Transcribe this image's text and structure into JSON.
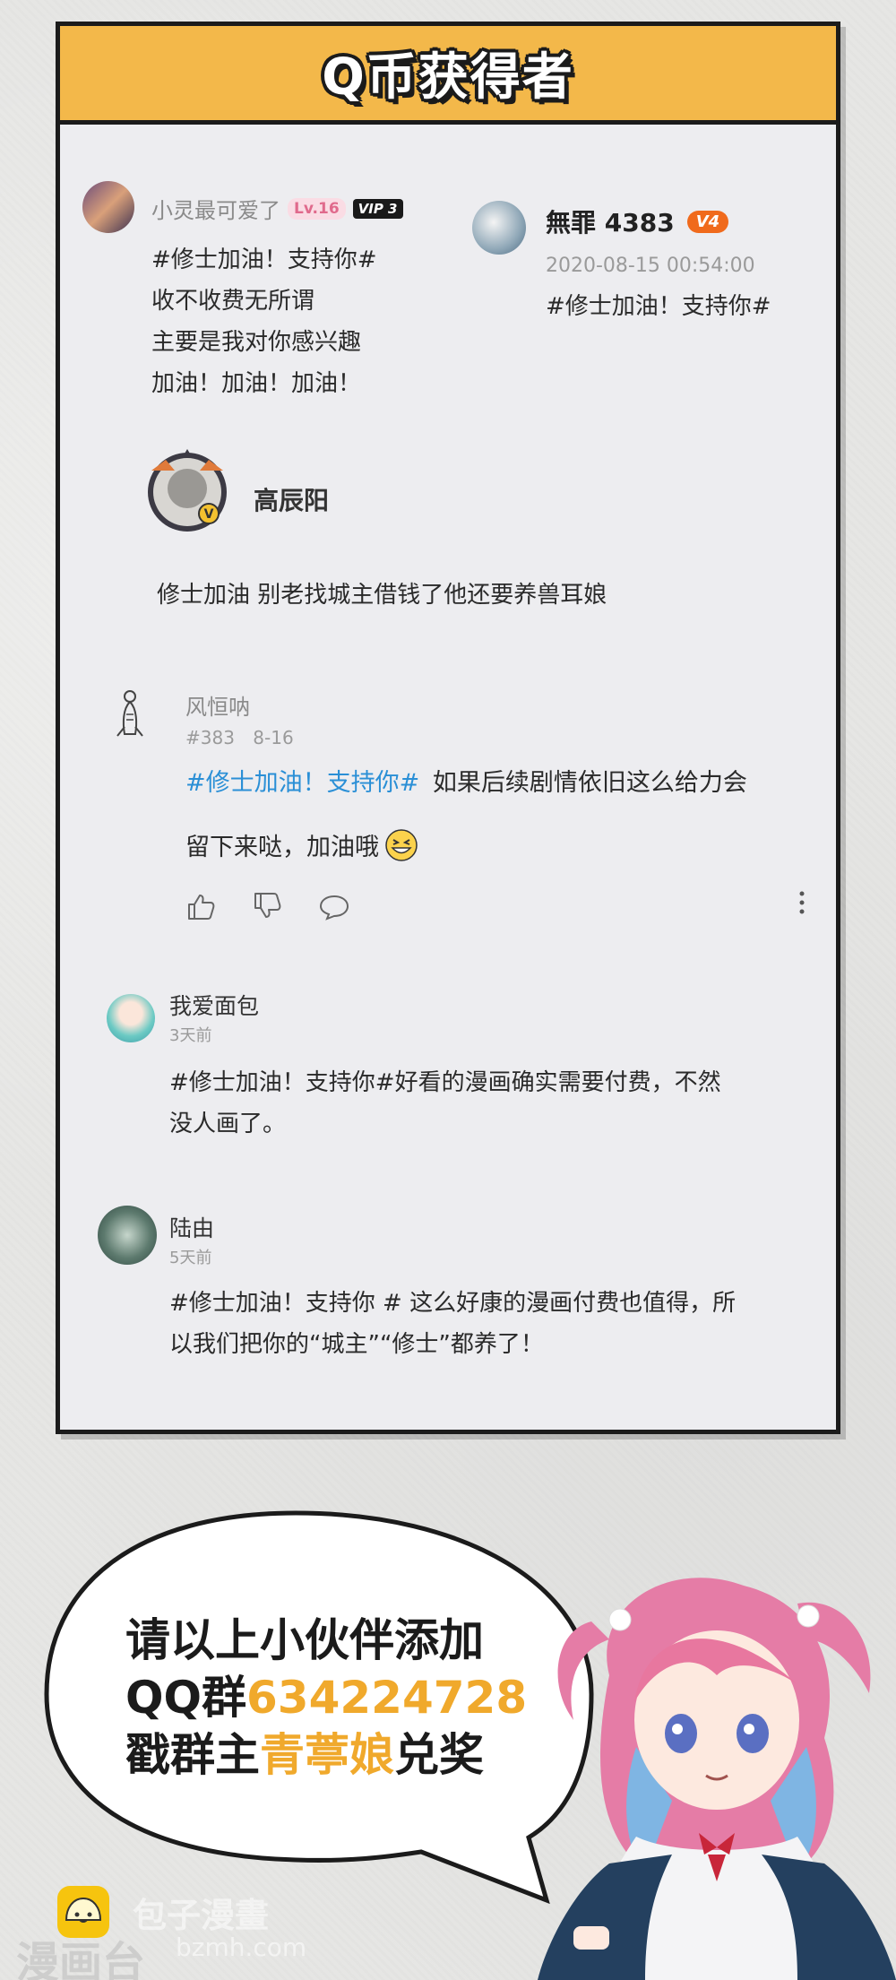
{
  "panel": {
    "title": "Q币获得者"
  },
  "comments": [
    {
      "user": "小灵最可爱了",
      "level": "Lv.16",
      "vip": "VIP 3",
      "lines": [
        "#修士加油！支持你#",
        "收不收费无所谓",
        "主要是我对你感兴趣",
        "加油！加油！加油！"
      ]
    },
    {
      "user": "無罪 4383",
      "badge": "V4",
      "time": "2020-08-15 00:54:00",
      "text": "#修士加油！支持你#"
    },
    {
      "user": "高辰阳",
      "text": "修士加油 别老找城主借钱了他还要养兽耳娘"
    },
    {
      "user": "风恒呐",
      "floor": "#383",
      "date": "8-16",
      "tag": "#修士加油！支持你#",
      "text1": "如果后续剧情依旧这么给力会",
      "text2": "留下来哒，加油哦"
    },
    {
      "user": "我爱面包",
      "time": "3天前",
      "lines": [
        "#修士加油！支持你#好看的漫画确实需要付费，不然",
        "没人画了。"
      ]
    },
    {
      "user": "陆由",
      "time": "5天前",
      "lines": [
        "#修士加油！支持你 # 这么好康的漫画付费也值得，所",
        "以我们把你的“城主”“修士”都养了！"
      ]
    }
  ],
  "bubble": {
    "line1": "请以上小伙伴添加",
    "line2_prefix": "QQ群",
    "line2_number": "634224728",
    "line3_prefix": "戳群主",
    "line3_name": "青葶娘",
    "line3_suffix": "兑奖"
  },
  "watermark": {
    "text1": "包子漫畫",
    "text2": "漫画台",
    "text3": "bzmh.com"
  },
  "colors": {
    "header": "#f3b84a",
    "accent": "#f0a92c",
    "link": "#2a8fd6"
  }
}
